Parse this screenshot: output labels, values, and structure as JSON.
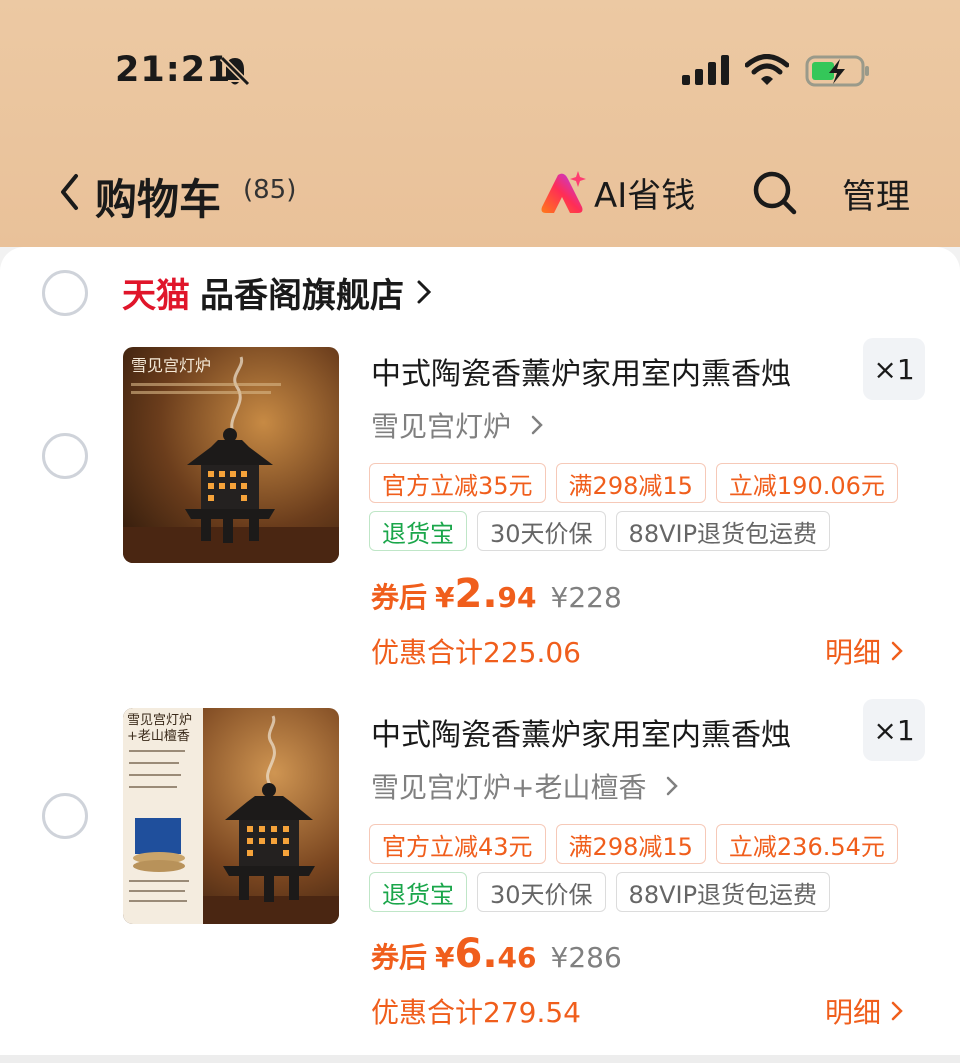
{
  "status_bar": {
    "time": "21:21"
  },
  "nav": {
    "title": "购物车",
    "count": "(85)",
    "ai_label": "AI省钱",
    "manage_label": "管理"
  },
  "store": {
    "badge": "天猫",
    "name": "品香阁旗舰店"
  },
  "products": [
    {
      "name": "中式陶瓷香薰炉家用室内熏香烛",
      "sku": "雪见宫灯炉",
      "qty": "×1",
      "image_text": "雪见宫灯炉",
      "promo_tags": [
        "官方立减35元",
        "满298减15",
        "立减190.06元"
      ],
      "service_tags": [
        "退货宝",
        "30天价保",
        "88VIP退货包运费"
      ],
      "coupon_label": "券后",
      "price_symbol": "¥",
      "price_int": "2.",
      "price_dec": "94",
      "original_price": "¥228",
      "saving": "优惠合计225.06",
      "detail_label": "明细"
    },
    {
      "name": "中式陶瓷香薰炉家用室内熏香烛",
      "sku": "雪见宫灯炉+老山檀香",
      "qty": "×1",
      "image_text": "雪见宫灯炉",
      "image_text2": "+老山檀香",
      "promo_tags": [
        "官方立减43元",
        "满298减15",
        "立减236.54元"
      ],
      "service_tags": [
        "退货宝",
        "30天价保",
        "88VIP退货包运费"
      ],
      "coupon_label": "券后",
      "price_symbol": "¥",
      "price_int": "6.",
      "price_dec": "46",
      "original_price": "¥286",
      "saving": "优惠合计279.54",
      "detail_label": "明细"
    }
  ],
  "colors": {
    "accent": "#f05e1c",
    "tmall_red": "#e0152a",
    "header_bg": "#ecc9a3",
    "green": "#1aa64a"
  }
}
